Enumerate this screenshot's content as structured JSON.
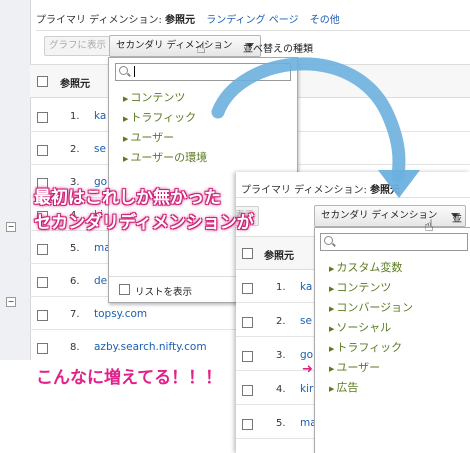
{
  "back_screen": {
    "primary_dim_label": "プライマリ ディメンション:",
    "primary_dim_value": "参照元",
    "landing_page_link": "ランディング ページ",
    "other_link": "その他",
    "graph_button": "グラフに表示",
    "secondary_dim_button": "セカンダリ ディメンション",
    "sort_label": "並べ替えの種類",
    "table_header": "参照元",
    "rows": [
      {
        "num": "1.",
        "text": "ka"
      },
      {
        "num": "2.",
        "text": "se"
      },
      {
        "num": "3.",
        "text": "go"
      },
      {
        "num": "4.",
        "text": "ki"
      },
      {
        "num": "5.",
        "text": "ma"
      },
      {
        "num": "6.",
        "text": "de"
      },
      {
        "num": "7.",
        "text": "topsy.com"
      },
      {
        "num": "8.",
        "text": "azby.search.nifty.com"
      }
    ],
    "dropdown_items": [
      "コンテンツ",
      "トラフィック",
      "ユーザー",
      "ユーザーの環境"
    ],
    "list_display_label": "リストを表示"
  },
  "front_screen": {
    "primary_dim_label": "プライマリ ディメンション:",
    "primary_dim_value": "参照元",
    "graph_button": "表示",
    "secondary_dim_button": "セカンダリ ディメンション",
    "sort_fragment": "並",
    "table_header": "参照元",
    "rows": [
      {
        "num": "1.",
        "text": "ka"
      },
      {
        "num": "2.",
        "text": "se"
      },
      {
        "num": "3.",
        "text": "go"
      },
      {
        "num": "4.",
        "text": "kir"
      },
      {
        "num": "5.",
        "text": "ma"
      }
    ],
    "dropdown_items": [
      "カスタム変数",
      "コンテンツ",
      "コンバージョン",
      "ソーシャル",
      "トラフィック",
      "ユーザー",
      "広告"
    ]
  },
  "annotations": {
    "before_line1": "最初はこれしか無かった",
    "before_line2": "セカンダリディメンションが",
    "after": "こんなに増えてる！！！"
  },
  "colors": {
    "accent_pink": "#e0218a",
    "arrow_blue": "#6bb0de",
    "link_blue": "#1a5fb4",
    "dropdown_green": "#5a7a1f"
  }
}
